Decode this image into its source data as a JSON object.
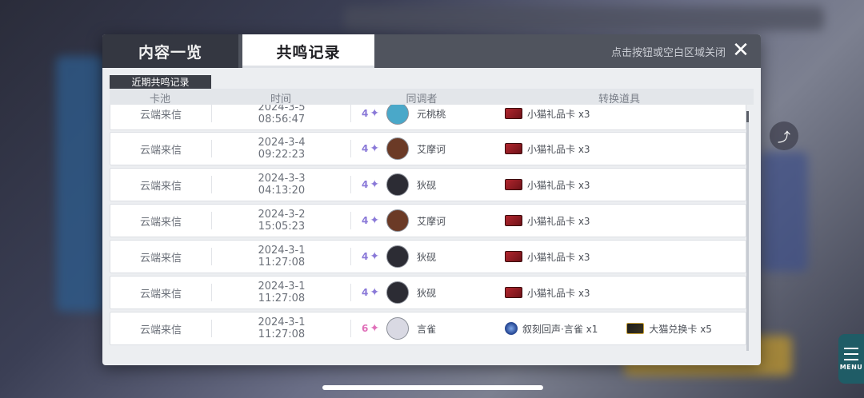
{
  "dialog": {
    "tabs": [
      {
        "label": "内容一览"
      },
      {
        "label": "共鸣记录"
      }
    ],
    "close_hint": "点击按钮或空白区域关闭",
    "section_label": "近期共鸣记录",
    "columns": [
      "卡池",
      "时间",
      "同调者",
      "转换道具"
    ]
  },
  "records": [
    {
      "pool": "云端来信",
      "date": "2024-3-5",
      "time": "08:56:47",
      "rarity": "4",
      "character": "元桃桃",
      "items": [
        {
          "name": "小猫礼品卡 x3",
          "icon": "red-gift-card-icon"
        }
      ]
    },
    {
      "pool": "云端来信",
      "date": "2024-3-4",
      "time": "09:22:23",
      "rarity": "4",
      "character": "艾摩诃",
      "items": [
        {
          "name": "小猫礼品卡 x3",
          "icon": "red-gift-card-icon"
        }
      ]
    },
    {
      "pool": "云端来信",
      "date": "2024-3-3",
      "time": "04:13:20",
      "rarity": "4",
      "character": "狄砚",
      "items": [
        {
          "name": "小猫礼品卡 x3",
          "icon": "red-gift-card-icon"
        }
      ]
    },
    {
      "pool": "云端来信",
      "date": "2024-3-2",
      "time": "15:05:23",
      "rarity": "4",
      "character": "艾摩诃",
      "items": [
        {
          "name": "小猫礼品卡 x3",
          "icon": "red-gift-card-icon"
        }
      ]
    },
    {
      "pool": "云端来信",
      "date": "2024-3-1",
      "time": "11:27:08",
      "rarity": "4",
      "character": "狄砚",
      "items": [
        {
          "name": "小猫礼品卡 x3",
          "icon": "red-gift-card-icon"
        }
      ]
    },
    {
      "pool": "云端来信",
      "date": "2024-3-1",
      "time": "11:27:08",
      "rarity": "4",
      "character": "狄砚",
      "items": [
        {
          "name": "小猫礼品卡 x3",
          "icon": "red-gift-card-icon"
        }
      ]
    },
    {
      "pool": "云端来信",
      "date": "2024-3-1",
      "time": "11:27:08",
      "rarity": "6",
      "character": "言雀",
      "items": [
        {
          "name": "叙刻回声·言雀 x1",
          "icon": "echo-orb-icon"
        },
        {
          "name": "大猫兑换卡 x5",
          "icon": "gold-exchange-card-icon"
        }
      ]
    }
  ],
  "side": {
    "menu_label": "MENU"
  },
  "colors": {
    "tab_active_bg": "#ffffff",
    "tab_inactive_bg": "#343741",
    "rarity4": "#8a79d8",
    "rarity6": "#e070b9"
  }
}
